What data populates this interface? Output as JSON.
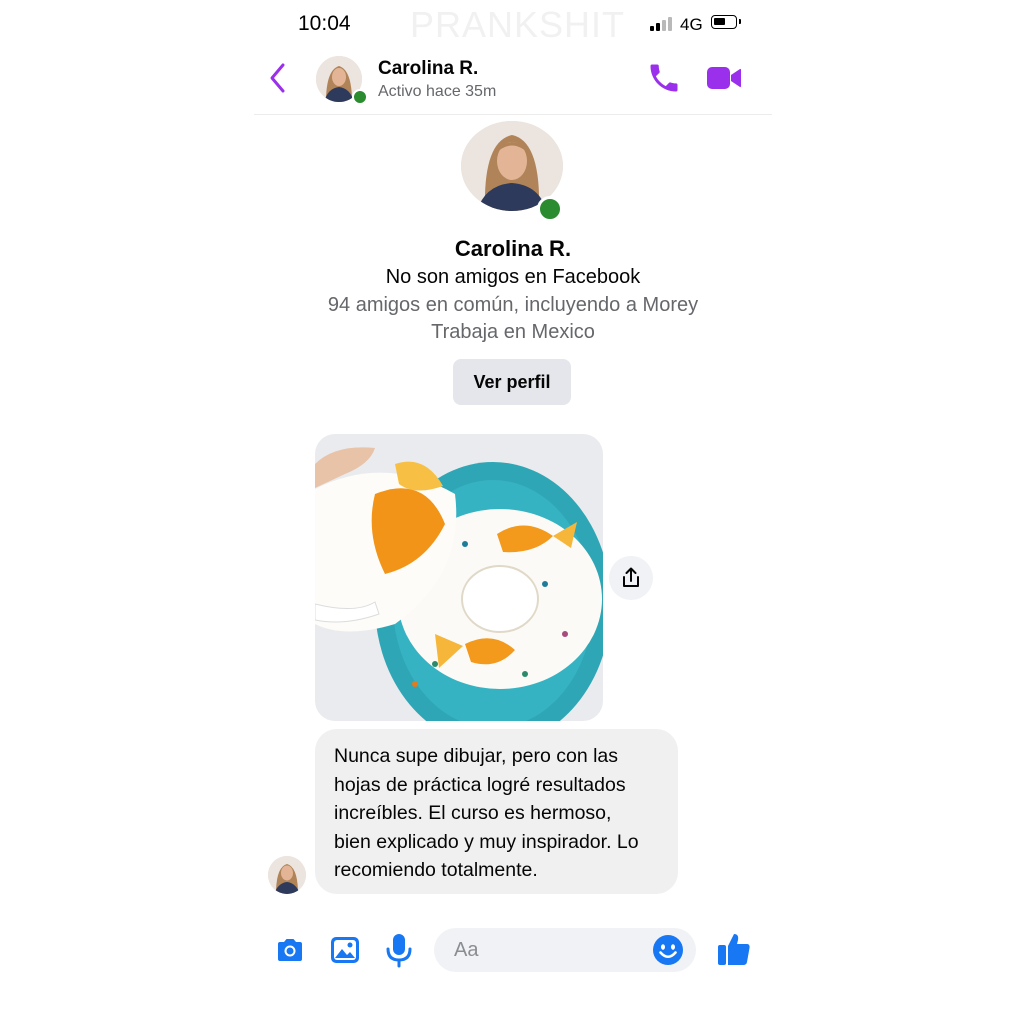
{
  "status_bar": {
    "time": "10:04",
    "network": "4G",
    "watermark": "PRANKSHIT",
    "battery_level": 0.5
  },
  "header": {
    "contact_name": "Carolina R.",
    "activity": "Activo hace 35m",
    "icons": {
      "back": "chevron-left-icon",
      "call": "phone-icon",
      "video": "video-camera-icon"
    }
  },
  "profile": {
    "name": "Carolina R.",
    "relation": "No son amigos en Facebook",
    "mutual_friends": "94 amigos en común, incluyendo a Morey",
    "work": "Trabaja en Mexico",
    "view_profile_label": "Ver perfil",
    "online": true
  },
  "messages": [
    {
      "type": "image",
      "description_icon": "painted-teacup-image",
      "share_icon": "share-icon"
    },
    {
      "type": "text",
      "lines": [
        "Nunca supe dibujar, pero con las",
        "hojas de práctica logré resultados",
        "increíbles. El curso es hermoso,",
        "bien explicado y muy inspirador. Lo",
        "recomiendo totalmente."
      ]
    }
  ],
  "composer": {
    "placeholder": "Aa",
    "icons": [
      "camera-icon",
      "gallery-icon",
      "microphone-icon",
      "emoji-icon",
      "thumbs-up-icon"
    ]
  },
  "colors": {
    "accent_purple": "#9b30ec",
    "accent_blue": "#1877f2",
    "online_green": "#2a8b2f",
    "bubble_gray": "#f0f0f0"
  }
}
